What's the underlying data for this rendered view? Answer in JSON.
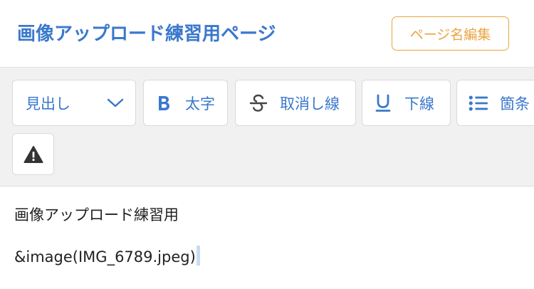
{
  "header": {
    "title": "画像アップロード練習用ページ",
    "edit_name_button": "ページ名編集"
  },
  "toolbar": {
    "heading_select": {
      "label": "見出し",
      "icon": "chevron-down-icon"
    },
    "bold": {
      "label": "太字",
      "icon": "bold-icon"
    },
    "strikethrough": {
      "label": "取消し線",
      "icon": "strikethrough-icon"
    },
    "underline": {
      "label": "下線",
      "icon": "underline-icon"
    },
    "bullet_list": {
      "label": "箇条",
      "icon": "bullet-list-icon"
    },
    "alert": {
      "icon": "warning-icon"
    }
  },
  "editor": {
    "lines": [
      "画像アップロード練習用",
      "&image(IMG_6789.jpeg)"
    ]
  },
  "colors": {
    "accent_blue": "#3a78cc",
    "accent_orange": "#e9a43f",
    "toolbar_bg": "#f1f1f1",
    "text": "#222222"
  }
}
